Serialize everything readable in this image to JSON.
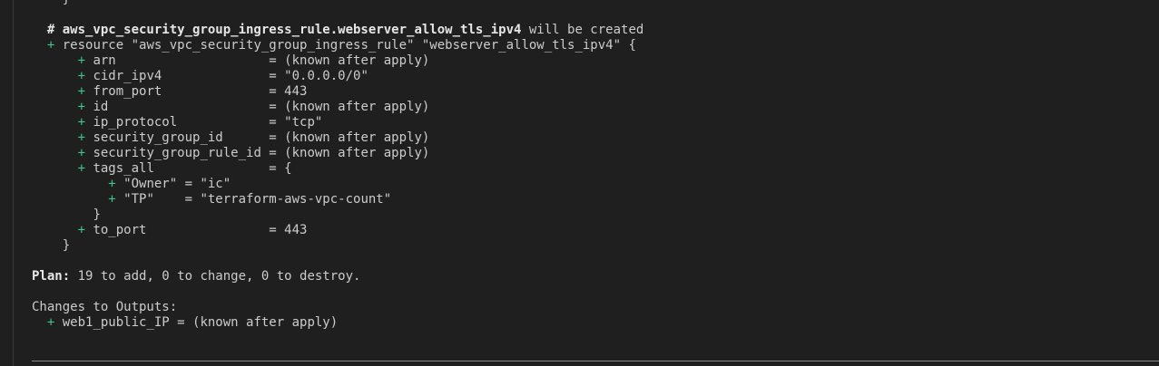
{
  "terminal": {
    "lines": [
      {
        "indent": "    ",
        "text": "}"
      },
      {
        "indent": "",
        "text": ""
      },
      {
        "indent": "  ",
        "bold": "# aws_vpc_security_group_ingress_rule.webserver_allow_tls_ipv4",
        "text": " will be created"
      },
      {
        "indent": "  ",
        "plus": "+",
        "text": " resource \"aws_vpc_security_group_ingress_rule\" \"webserver_allow_tls_ipv4\" {"
      },
      {
        "indent": "      ",
        "plus": "+",
        "text": " arn                    = (known after apply)"
      },
      {
        "indent": "      ",
        "plus": "+",
        "text": " cidr_ipv4              = \"0.0.0.0/0\""
      },
      {
        "indent": "      ",
        "plus": "+",
        "text": " from_port              = 443"
      },
      {
        "indent": "      ",
        "plus": "+",
        "text": " id                     = (known after apply)"
      },
      {
        "indent": "      ",
        "plus": "+",
        "text": " ip_protocol            = \"tcp\""
      },
      {
        "indent": "      ",
        "plus": "+",
        "text": " security_group_id      = (known after apply)"
      },
      {
        "indent": "      ",
        "plus": "+",
        "text": " security_group_rule_id = (known after apply)"
      },
      {
        "indent": "      ",
        "plus": "+",
        "text": " tags_all               = {"
      },
      {
        "indent": "          ",
        "plus": "+",
        "text": " \"Owner\" = \"ic\""
      },
      {
        "indent": "          ",
        "plus": "+",
        "text": " \"TP\"    = \"terraform-aws-vpc-count\""
      },
      {
        "indent": "        ",
        "text": "}"
      },
      {
        "indent": "      ",
        "plus": "+",
        "text": " to_port                = 443"
      },
      {
        "indent": "    ",
        "text": "}"
      },
      {
        "indent": "",
        "text": ""
      },
      {
        "indent": "",
        "bold": "Plan:",
        "text": " 19 to add, 0 to change, 0 to destroy."
      },
      {
        "indent": "",
        "text": ""
      },
      {
        "indent": "",
        "text": "Changes to Outputs:"
      },
      {
        "indent": "  ",
        "plus": "+",
        "text": " web1_public_IP = (known after apply)"
      }
    ]
  },
  "colors": {
    "background": "#1f1f1f",
    "text": "#cccccc",
    "plus": "#3fc48a"
  }
}
